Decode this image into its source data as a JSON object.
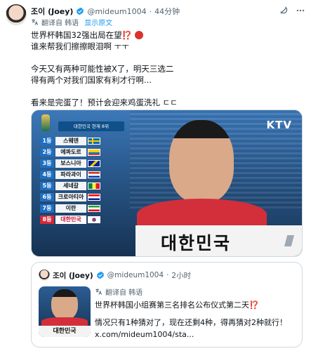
{
  "tweet": {
    "author_name": "조이 (Joey)",
    "handle": "@mideum1004",
    "separator": "·",
    "time": "44分钟",
    "translated_label": "翻译自 韩语",
    "show_original": "显示原文",
    "lines": [
      "世界杯韩国32强出局在望",
      "谁来帮我们擦擦眼泪啊 ㅜㅜ",
      "",
      "今天又有两种可能性被X了，明天三选二",
      "得有两个对我们国家有利才行啊...",
      "",
      "看来是完蛋了！预计会迎来鸡蛋洗礼 ㄷㄷ"
    ],
    "warn_emoji": "⁉️",
    "icons": {
      "verified": "verified-badge-icon",
      "grok": "grok-icon",
      "more": "more-icon",
      "translate": "translate-icon"
    }
  },
  "media": {
    "broadcaster": "KTV",
    "ranking_title": "대한민국 현재 8위",
    "ranking": [
      {
        "rank": "1등",
        "team": "스웨덴",
        "flag": "sweden"
      },
      {
        "rank": "2등",
        "team": "에콰도르",
        "flag": "ecuador"
      },
      {
        "rank": "3등",
        "team": "보스니아",
        "flag": "bosnia"
      },
      {
        "rank": "4등",
        "team": "파라과이",
        "flag": "paraguay"
      },
      {
        "rank": "5등",
        "team": "세네갈",
        "flag": "senegal"
      },
      {
        "rank": "6등",
        "team": "크로아티아",
        "flag": "croatia"
      },
      {
        "rank": "7등",
        "team": "이란",
        "flag": "iran"
      },
      {
        "rank": "8등",
        "team": "대한민국",
        "flag": "korea"
      }
    ],
    "caption": "대한민국"
  },
  "quote": {
    "author_name": "조이 (Joey)",
    "handle": "@mideum1004",
    "separator": "·",
    "time": "2小时",
    "translated_label": "翻译自 韩语",
    "line1": "世界杯韩国小组赛第三名排名公布仪式第二天⁉️",
    "line2": "情况只有1种猜对了，现在还剩4种，得再猜对2种就行！",
    "link": "x.com/mideum1004/sta...",
    "thumb_caption": "대한민국"
  }
}
